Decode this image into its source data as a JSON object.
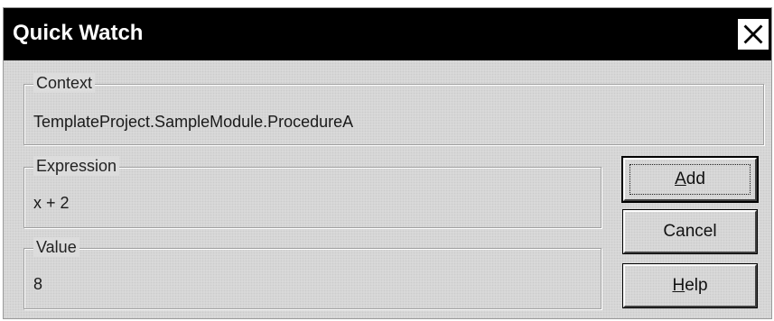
{
  "window": {
    "title": "Quick Watch",
    "close_icon": "close-icon"
  },
  "context": {
    "label": "Context",
    "value": "TemplateProject.SampleModule.ProcedureA"
  },
  "expression": {
    "label": "Expression",
    "value": "x + 2"
  },
  "value_group": {
    "label": "Value",
    "value": "8"
  },
  "buttons": {
    "add": {
      "mnemonic": "A",
      "rest": "dd"
    },
    "cancel": {
      "label": "Cancel"
    },
    "help": {
      "mnemonic": "H",
      "rest": "elp"
    }
  },
  "colors": {
    "titlebar": "#000000",
    "title_text": "#ffffff",
    "dialog_bg": "#dcdcdc"
  }
}
